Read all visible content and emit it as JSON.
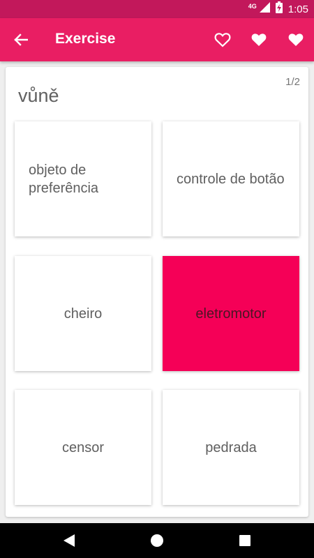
{
  "status_bar": {
    "network": "4G",
    "time": "1:05",
    "icons": [
      "signal-icon",
      "battery-charging-icon"
    ]
  },
  "app_bar": {
    "title": "Exercise",
    "back_icon": "arrow-left-icon",
    "actions": [
      "heart-outline-icon",
      "heart-filled-icon",
      "heart-filled-icon"
    ]
  },
  "quiz": {
    "word": "vůně",
    "progress": "1/2",
    "options": [
      {
        "label": "objeto de preferência",
        "selected": false
      },
      {
        "label": "controle de botão",
        "selected": false
      },
      {
        "label": "cheiro",
        "selected": false
      },
      {
        "label": "eletromotor",
        "selected": true
      },
      {
        "label": "censor",
        "selected": false
      },
      {
        "label": "pedrada",
        "selected": false
      }
    ]
  },
  "nav_bar": {
    "buttons": [
      "back-triangle-icon",
      "home-circle-icon",
      "recents-square-icon"
    ]
  },
  "colors": {
    "status_bar": "#c2185b",
    "app_bar": "#e91e63",
    "selected_option": "#f50057"
  }
}
